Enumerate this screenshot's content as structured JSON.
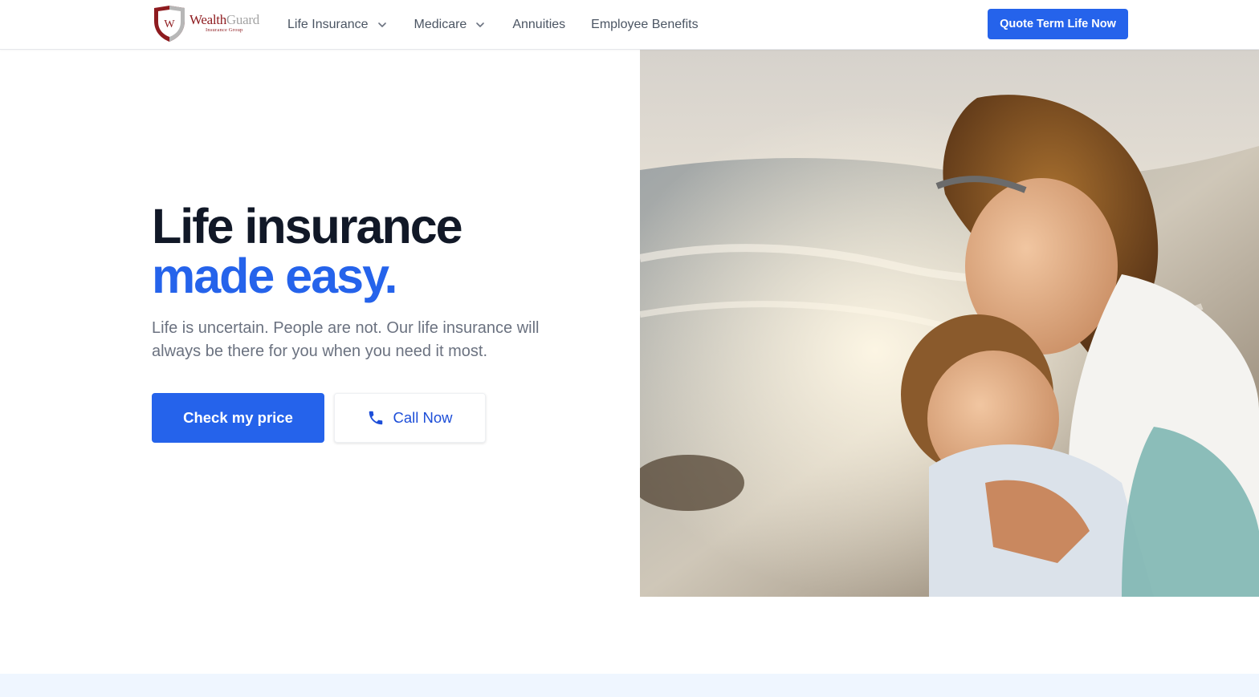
{
  "brand": {
    "name_part1": "Wealth",
    "name_part2": "Guard",
    "tagline": "Insurance Group",
    "monogram": "W",
    "colors": {
      "shield_red": "#8e1b1f",
      "shield_gray": "#9ca3af"
    }
  },
  "nav": {
    "items": [
      {
        "label": "Life Insurance",
        "has_dropdown": true
      },
      {
        "label": "Medicare",
        "has_dropdown": true
      },
      {
        "label": "Annuities",
        "has_dropdown": false
      },
      {
        "label": "Employee Benefits",
        "has_dropdown": false
      }
    ],
    "dropdown_icon": "chevron-down-icon"
  },
  "header": {
    "cta_label": "Quote Term Life Now"
  },
  "hero": {
    "title_line1": "Life insurance",
    "title_line2": "made easy.",
    "subtitle": "Life is uncertain. People are not. Our life insurance will always be there for you when you need it most.",
    "primary_cta": "Check my price",
    "secondary_cta": "Call Now",
    "secondary_icon": "phone-icon",
    "image_subject": "photo"
  },
  "colors": {
    "accent": "#2563eb",
    "heading": "#111827",
    "body_text": "#6b7280",
    "nav_text": "#4b5563",
    "band": "#eff6ff"
  }
}
